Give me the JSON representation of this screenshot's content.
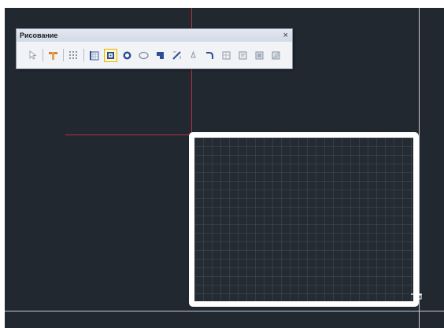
{
  "toolbar": {
    "title": "Рисование",
    "close_glyph": "×",
    "buttons": [
      {
        "icon": "select-arrow-icon",
        "active": false
      },
      {
        "icon": "wall-tool-icon",
        "active": false
      },
      {
        "icon": "grid-dots-icon",
        "active": false
      },
      {
        "icon": "ruler-grid-icon",
        "active": false
      },
      {
        "icon": "rectangle-snap-icon",
        "active": true
      },
      {
        "icon": "circle-icon",
        "active": false
      },
      {
        "icon": "ellipse-icon",
        "active": false
      },
      {
        "icon": "polyline-icon",
        "active": false
      },
      {
        "icon": "diagonal-line-icon",
        "active": false
      },
      {
        "icon": "point-icon",
        "active": false
      },
      {
        "icon": "arc-icon",
        "active": false
      },
      {
        "icon": "hatch-icon",
        "active": false
      },
      {
        "icon": "text-box-icon",
        "active": false
      },
      {
        "icon": "image-icon",
        "active": false
      },
      {
        "icon": "table-icon",
        "active": false
      }
    ]
  },
  "colors": {
    "canvas": "#212830",
    "crosshair": "#b2323c",
    "frame": "#ffffff",
    "active_button": "#e6b400"
  }
}
